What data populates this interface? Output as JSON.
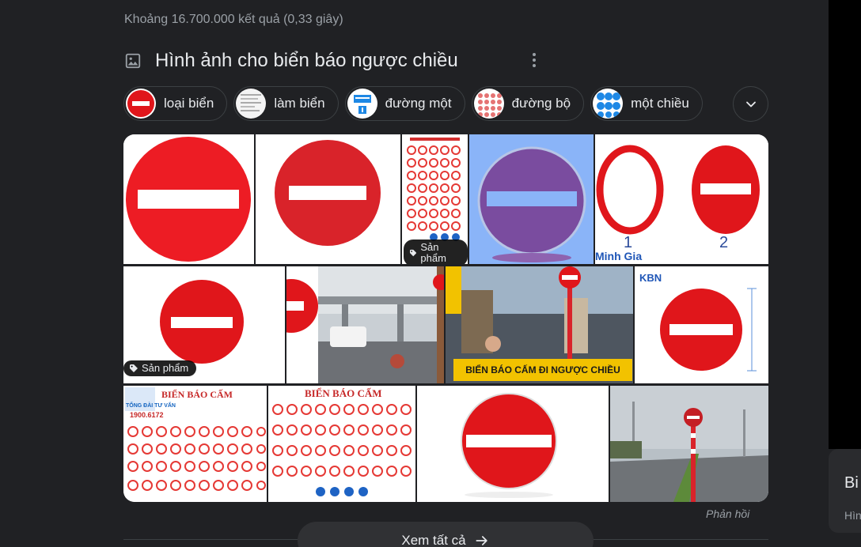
{
  "results": {
    "stats": "Khoảng 16.700.000 kết quả (0,33 giây)"
  },
  "images_section": {
    "title": "Hình ảnh cho biển báo ngược chiều",
    "chips": [
      {
        "label": "loại biển"
      },
      {
        "label": "làm biển"
      },
      {
        "label": "đường một"
      },
      {
        "label": "đường bộ"
      },
      {
        "label": "một chiều"
      }
    ],
    "badges": {
      "product_1": "Sản phẩm",
      "product_2": "Sản phẩm"
    },
    "tile_text": {
      "label_1": "1",
      "label_2": "2",
      "brand": "Minh Gia",
      "kbn": "KBN",
      "banner": "BIỂN BÁO CẤM ĐI NGƯỢC CHIỀU",
      "chart_title": "BIỂN BÁO CẤM",
      "hotline_label": "TỔNG ĐÀI TƯ VẤN",
      "hotline": "1900.6172"
    },
    "feedback": "Phản hồi",
    "see_all": "Xem tất cả"
  },
  "side_panel": {
    "title": "Bi",
    "subtitle": "Hìn"
  },
  "colors": {
    "background": "#202124",
    "sign_red": "#e0161b",
    "text": "#e8eaed",
    "muted": "#9aa0a6"
  }
}
